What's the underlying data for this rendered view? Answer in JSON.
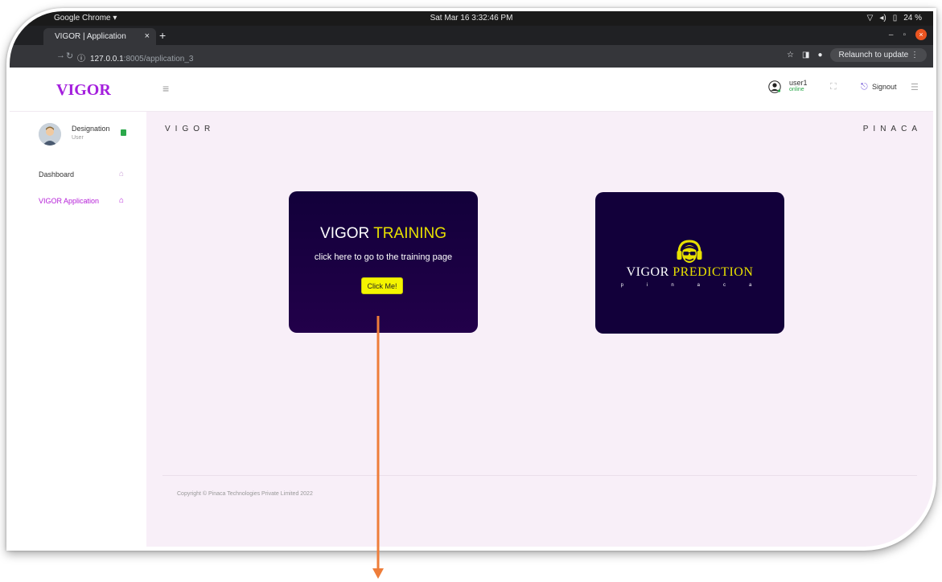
{
  "os_bar": {
    "app_menu": "Google Chrome ▾",
    "clock": "Sat Mar 16  3:32:46 PM",
    "battery": "24 %"
  },
  "browser": {
    "tab_title": "VIGOR | Application",
    "new_tab": "+",
    "url_host": "127.0.0.1",
    "url_path": ":8005/application_3",
    "relaunch_label": "Relaunch to update"
  },
  "header": {
    "brand": "VIGOR",
    "user_name": "user1",
    "user_status": "online",
    "signout_label": "Signout"
  },
  "sidebar": {
    "designation": "Designation",
    "role": "User",
    "items": [
      {
        "label": "Dashboard",
        "active": false
      },
      {
        "label": "VIGOR Application",
        "active": true
      }
    ]
  },
  "main": {
    "left_label": "VIGOR",
    "right_label": "PINACA",
    "training_card": {
      "title_plain": "VIGOR ",
      "title_accent": "TRAINING",
      "description": "click here to go to the training page",
      "button_label": "Click Me!"
    },
    "prediction_card": {
      "title_plain": "VIGOR ",
      "title_accent": "PREDICTION",
      "subtitle": "pinaca"
    },
    "copyright": "Copyright © Pinaca Technologies Private Limited 2022"
  },
  "colors": {
    "brand": "#a41fdd",
    "card_bg": "#12003a",
    "accent_yellow": "#e8e000",
    "active_nav": "#b51fd8",
    "arrow": "#ee7d3a"
  }
}
